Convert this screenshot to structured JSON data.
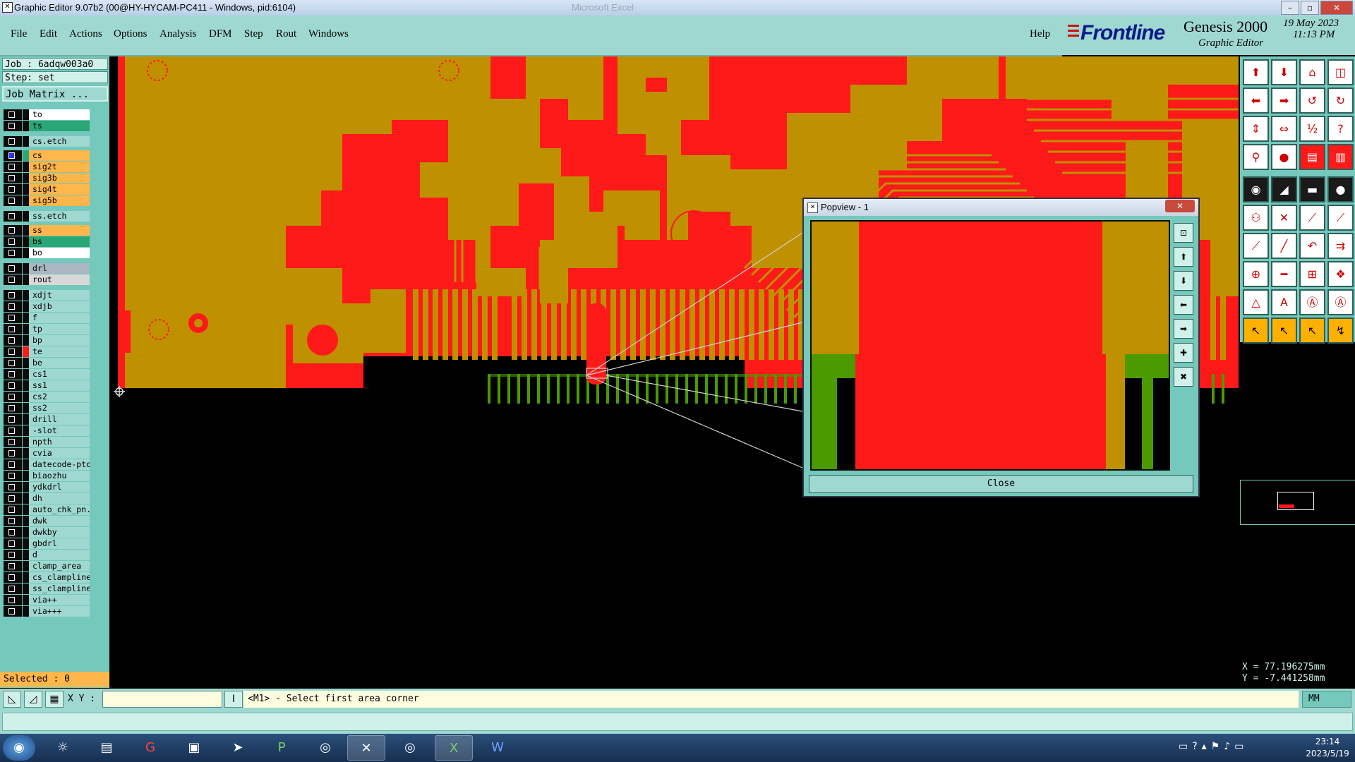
{
  "window": {
    "title": "Graphic Editor 9.07b2 (00@HY-HYCAM-PC411 - Windows, pid:6104)",
    "background_title": "Microsoft Excel"
  },
  "menu": {
    "items": [
      "File",
      "Edit",
      "Actions",
      "Options",
      "Analysis",
      "DFM",
      "Step",
      "Rout",
      "Windows"
    ],
    "help": "Help"
  },
  "brand": {
    "logo": "Frontline",
    "product": "Genesis 2000",
    "subtitle": "Graphic Editor",
    "date": "19 May 2023",
    "time": "11:13 PM"
  },
  "left_panel": {
    "job": "Job : 6adqw003a0",
    "step": "Step: set",
    "matrix_button": "Job Matrix ...",
    "layers": [
      {
        "name": "to",
        "color": "#ffffff"
      },
      {
        "name": "ts",
        "color": "#2aa776"
      },
      {
        "name": "cs.etch",
        "color": "#9fd8d0"
      },
      {
        "name": "cs",
        "color": "#ffb64a",
        "selected": true
      },
      {
        "name": "sig2t",
        "color": "#ffb64a"
      },
      {
        "name": "sig3b",
        "color": "#ffb64a"
      },
      {
        "name": "sig4t",
        "color": "#ffb64a"
      },
      {
        "name": "sig5b",
        "color": "#ffb64a"
      },
      {
        "name": "ss.etch",
        "color": "#9fd8d0"
      },
      {
        "name": "ss",
        "color": "#ffb64a"
      },
      {
        "name": "bs",
        "color": "#2aa776"
      },
      {
        "name": "bo",
        "color": "#ffffff"
      },
      {
        "name": "drl",
        "color": "#a9b8c0"
      },
      {
        "name": "rout",
        "color": "#d8d8d8"
      },
      {
        "name": "xdjt",
        "color": "#9fd8d0"
      },
      {
        "name": "xdjb",
        "color": "#9fd8d0"
      },
      {
        "name": "f",
        "color": "#9fd8d0"
      },
      {
        "name": "tp",
        "color": "#9fd8d0"
      },
      {
        "name": "bp",
        "color": "#9fd8d0"
      },
      {
        "name": "te",
        "color": "#9fd8d0",
        "swatch": "#ff1a1a"
      },
      {
        "name": "be",
        "color": "#9fd8d0"
      },
      {
        "name": "cs1",
        "color": "#9fd8d0"
      },
      {
        "name": "ss1",
        "color": "#9fd8d0"
      },
      {
        "name": "cs2",
        "color": "#9fd8d0"
      },
      {
        "name": "ss2",
        "color": "#9fd8d0"
      },
      {
        "name": "drill",
        "color": "#9fd8d0"
      },
      {
        "name": "-slot",
        "color": "#9fd8d0"
      },
      {
        "name": "npth",
        "color": "#9fd8d0"
      },
      {
        "name": "cvia",
        "color": "#9fd8d0"
      },
      {
        "name": "datecode-pto",
        "color": "#9fd8d0"
      },
      {
        "name": "biaozhu",
        "color": "#9fd8d0"
      },
      {
        "name": "ydkdrl",
        "color": "#9fd8d0"
      },
      {
        "name": "dh",
        "color": "#9fd8d0"
      },
      {
        "name": "auto_chk_pn.",
        "color": "#9fd8d0"
      },
      {
        "name": "dwk",
        "color": "#9fd8d0"
      },
      {
        "name": "dwkby",
        "color": "#9fd8d0"
      },
      {
        "name": "gbdrl",
        "color": "#9fd8d0"
      },
      {
        "name": "d",
        "color": "#9fd8d0"
      },
      {
        "name": "clamp_area",
        "color": "#9fd8d0"
      },
      {
        "name": "cs_clampline",
        "color": "#9fd8d0"
      },
      {
        "name": "ss_clampline",
        "color": "#9fd8d0"
      },
      {
        "name": "via++",
        "color": "#9fd8d0"
      },
      {
        "name": "via+++",
        "color": "#9fd8d0"
      }
    ],
    "selected": "Selected : 0"
  },
  "popview": {
    "title": "Popview - 1",
    "close_label": "Close",
    "close_x": "✕"
  },
  "status": {
    "xy_label": "X Y :",
    "xy_value": "",
    "prompt": "<M1> - Select first area corner",
    "units": "MM",
    "x": "X = 77.196275mm",
    "y": "Y = -7.441258mm"
  },
  "taskbar": {
    "time": "23:14",
    "date": "2023/5/19"
  }
}
